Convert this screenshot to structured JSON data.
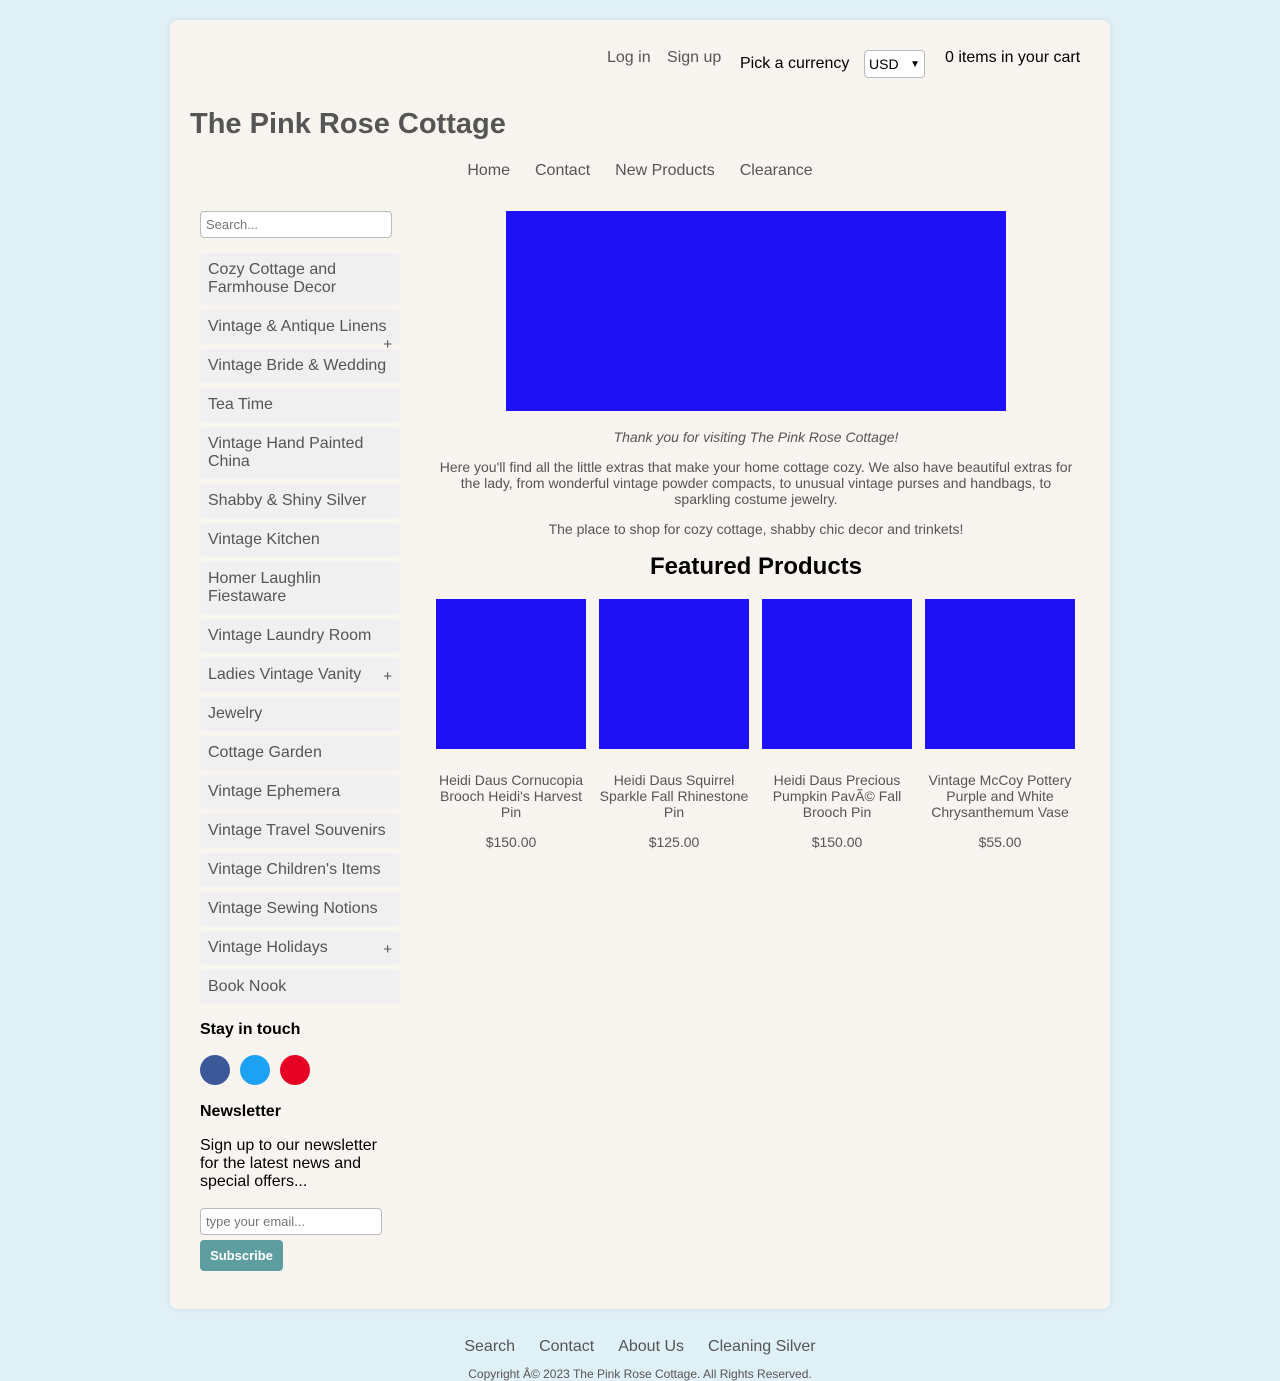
{
  "header": {
    "login": "Log in",
    "signup": "Sign up",
    "currency_label": "Pick a currency",
    "currency_value": "USD",
    "cart": "0 items in your cart",
    "site_title": "The Pink Rose Cottage"
  },
  "nav": [
    "Home",
    "Contact",
    "New Products",
    "Clearance"
  ],
  "sidebar": {
    "search_placeholder": "Search...",
    "categories": [
      {
        "label": "Cozy Cottage and Farmhouse Decor",
        "expandable": false
      },
      {
        "label": "Vintage & Antique Linens",
        "expandable": true
      },
      {
        "label": "Vintage Bride & Wedding",
        "expandable": false
      },
      {
        "label": "Tea Time",
        "expandable": false
      },
      {
        "label": "Vintage Hand Painted China",
        "expandable": false
      },
      {
        "label": "Shabby & Shiny Silver",
        "expandable": false
      },
      {
        "label": "Vintage Kitchen",
        "expandable": false
      },
      {
        "label": "Homer Laughlin Fiestaware",
        "expandable": false
      },
      {
        "label": "Vintage Laundry Room",
        "expandable": false
      },
      {
        "label": "Ladies Vintage Vanity",
        "expandable": true
      },
      {
        "label": "Jewelry",
        "expandable": false
      },
      {
        "label": "Cottage Garden",
        "expandable": false
      },
      {
        "label": "Vintage Ephemera",
        "expandable": false
      },
      {
        "label": "Vintage Travel Souvenirs",
        "expandable": false
      },
      {
        "label": "Vintage Children's Items",
        "expandable": false
      },
      {
        "label": "Vintage Sewing Notions",
        "expandable": false
      },
      {
        "label": "Vintage Holidays",
        "expandable": true
      },
      {
        "label": "Book Nook",
        "expandable": false
      }
    ],
    "expand_symbol": "+",
    "stay_in_touch": "Stay in touch",
    "social": [
      {
        "name": "facebook-icon",
        "color": "#3b5998"
      },
      {
        "name": "twitter-icon",
        "color": "#1da1f2"
      },
      {
        "name": "pinterest-icon",
        "color": "#e60023"
      }
    ],
    "newsletter_title": "Newsletter",
    "newsletter_text": "Sign up to our newsletter for the latest news and special offers...",
    "email_placeholder": "type your email...",
    "subscribe_label": "Subscribe",
    "subscribe_color": "#5f9ea0"
  },
  "main": {
    "hero_color": "#1f10f5",
    "welcome": "Thank you for visiting The Pink Rose Cottage!",
    "intro": "Here you'll find all the little extras that make your home cottage cozy. We also have beautiful extras for the lady, from wonderful vintage powder compacts, to unusual vintage purses and handbags, to sparkling costume jewelry.",
    "tagline": "The place to shop for cozy cottage, shabby chic decor and trinkets!",
    "featured_title": "Featured Products",
    "products": [
      {
        "name": "Heidi Daus Cornucopia Brooch Heidi's Harvest Pin",
        "price": "$150.00"
      },
      {
        "name": "Heidi Daus Squirrel Sparkle Fall Rhinestone Pin",
        "price": "$125.00"
      },
      {
        "name": "Heidi Daus Precious Pumpkin PavÃ© Fall Brooch Pin",
        "price": "$150.00"
      },
      {
        "name": "Vintage McCoy Pottery Purple and White Chrysanthemum Vase",
        "price": "$55.00"
      }
    ]
  },
  "footer": {
    "links": [
      "Search",
      "Contact",
      "About Us",
      "Cleaning Silver"
    ],
    "copyright": "Copyright Â© 2023 The Pink Rose Cottage. All Rights Reserved."
  }
}
